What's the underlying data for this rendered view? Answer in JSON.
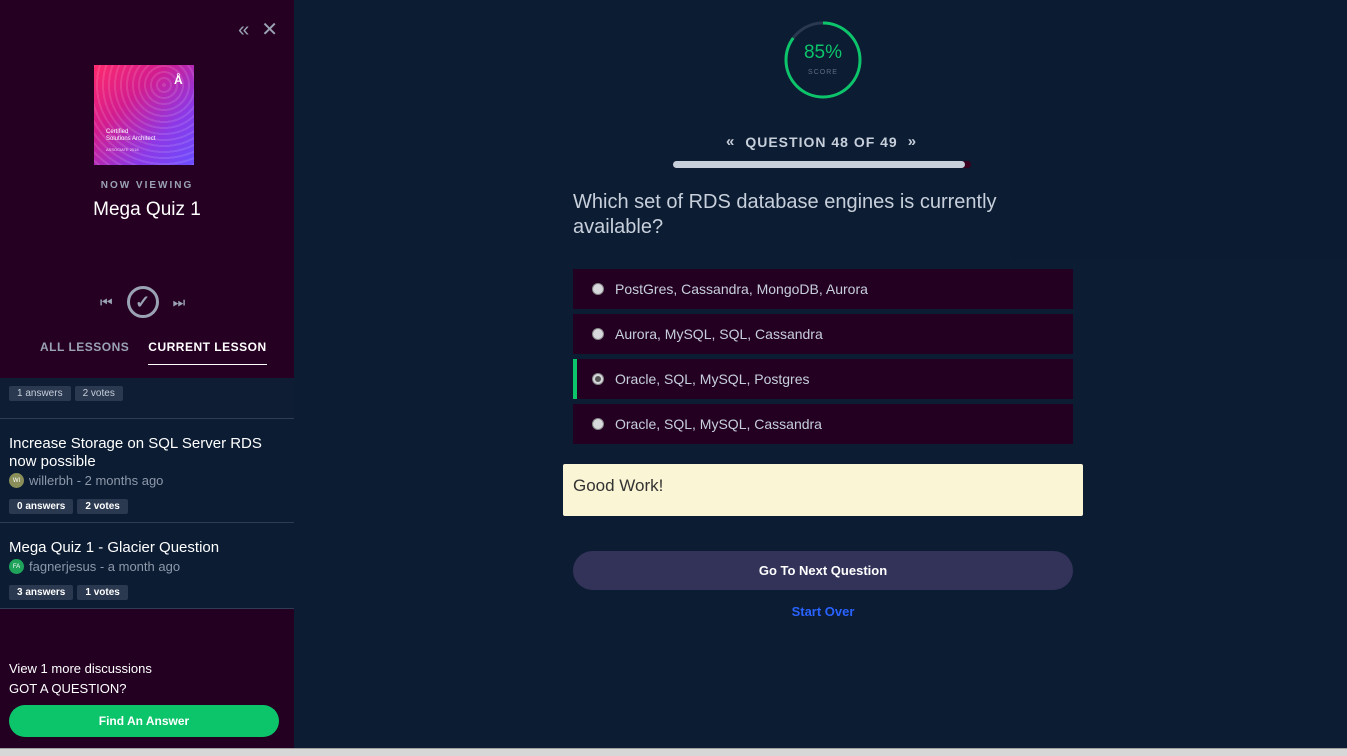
{
  "sidebar": {
    "icons": {
      "collapse": "double-chevron-left-icon",
      "close": "close-icon"
    },
    "course_art": {
      "line1": "Certified",
      "line2": "Solutions Architect",
      "line3": "ASSOCIATE 2018"
    },
    "now_viewing_label": "NOW VIEWING",
    "lesson_title": "Mega Quiz 1",
    "tabs": [
      {
        "label": "ALL LESSONS",
        "active": false
      },
      {
        "label": "CURRENT LESSON",
        "active": true
      }
    ],
    "discussions": [
      {
        "answers": "1 answers",
        "votes": "2 votes"
      },
      {
        "title": "Increase Storage on SQL Server RDS now possible",
        "avatar_initials": "WI",
        "avatar_color": "#8a8f5a",
        "author": "willerbh",
        "time": " - 2 months ago",
        "answers_count": "0",
        "answers_word": " answers",
        "votes": "2 votes"
      },
      {
        "title": "Mega Quiz 1 - Glacier Question",
        "avatar_initials": "FA",
        "avatar_color": "#1fa35a",
        "author": "fagnerjesus",
        "time": " - a month ago",
        "answers_count": "3",
        "answers_word": " answers",
        "votes": "1 votes"
      }
    ],
    "view_more": "View 1 more discussions",
    "got_question": "GOT A QUESTION?",
    "find_answer_button": "Find An Answer"
  },
  "main": {
    "score": {
      "value": "85%",
      "label": "SCORE",
      "percent": 85,
      "color": "#0cc46a"
    },
    "question_nav": "QUESTION 48 OF 49",
    "progress_fraction": 0.98,
    "question_text": "Which set of RDS database engines is currently available?",
    "options": [
      {
        "label": "PostGres, Cassandra, MongoDB, Aurora",
        "selected": false
      },
      {
        "label": "Aurora, MySQL, SQL, Cassandra",
        "selected": false
      },
      {
        "label": "Oracle, SQL, MySQL, Postgres",
        "selected": true
      },
      {
        "label": "Oracle, SQL, MySQL, Cassandra",
        "selected": false
      }
    ],
    "feedback": "Good Work!",
    "next_button": "Go To Next Question",
    "start_over": "Start Over"
  }
}
